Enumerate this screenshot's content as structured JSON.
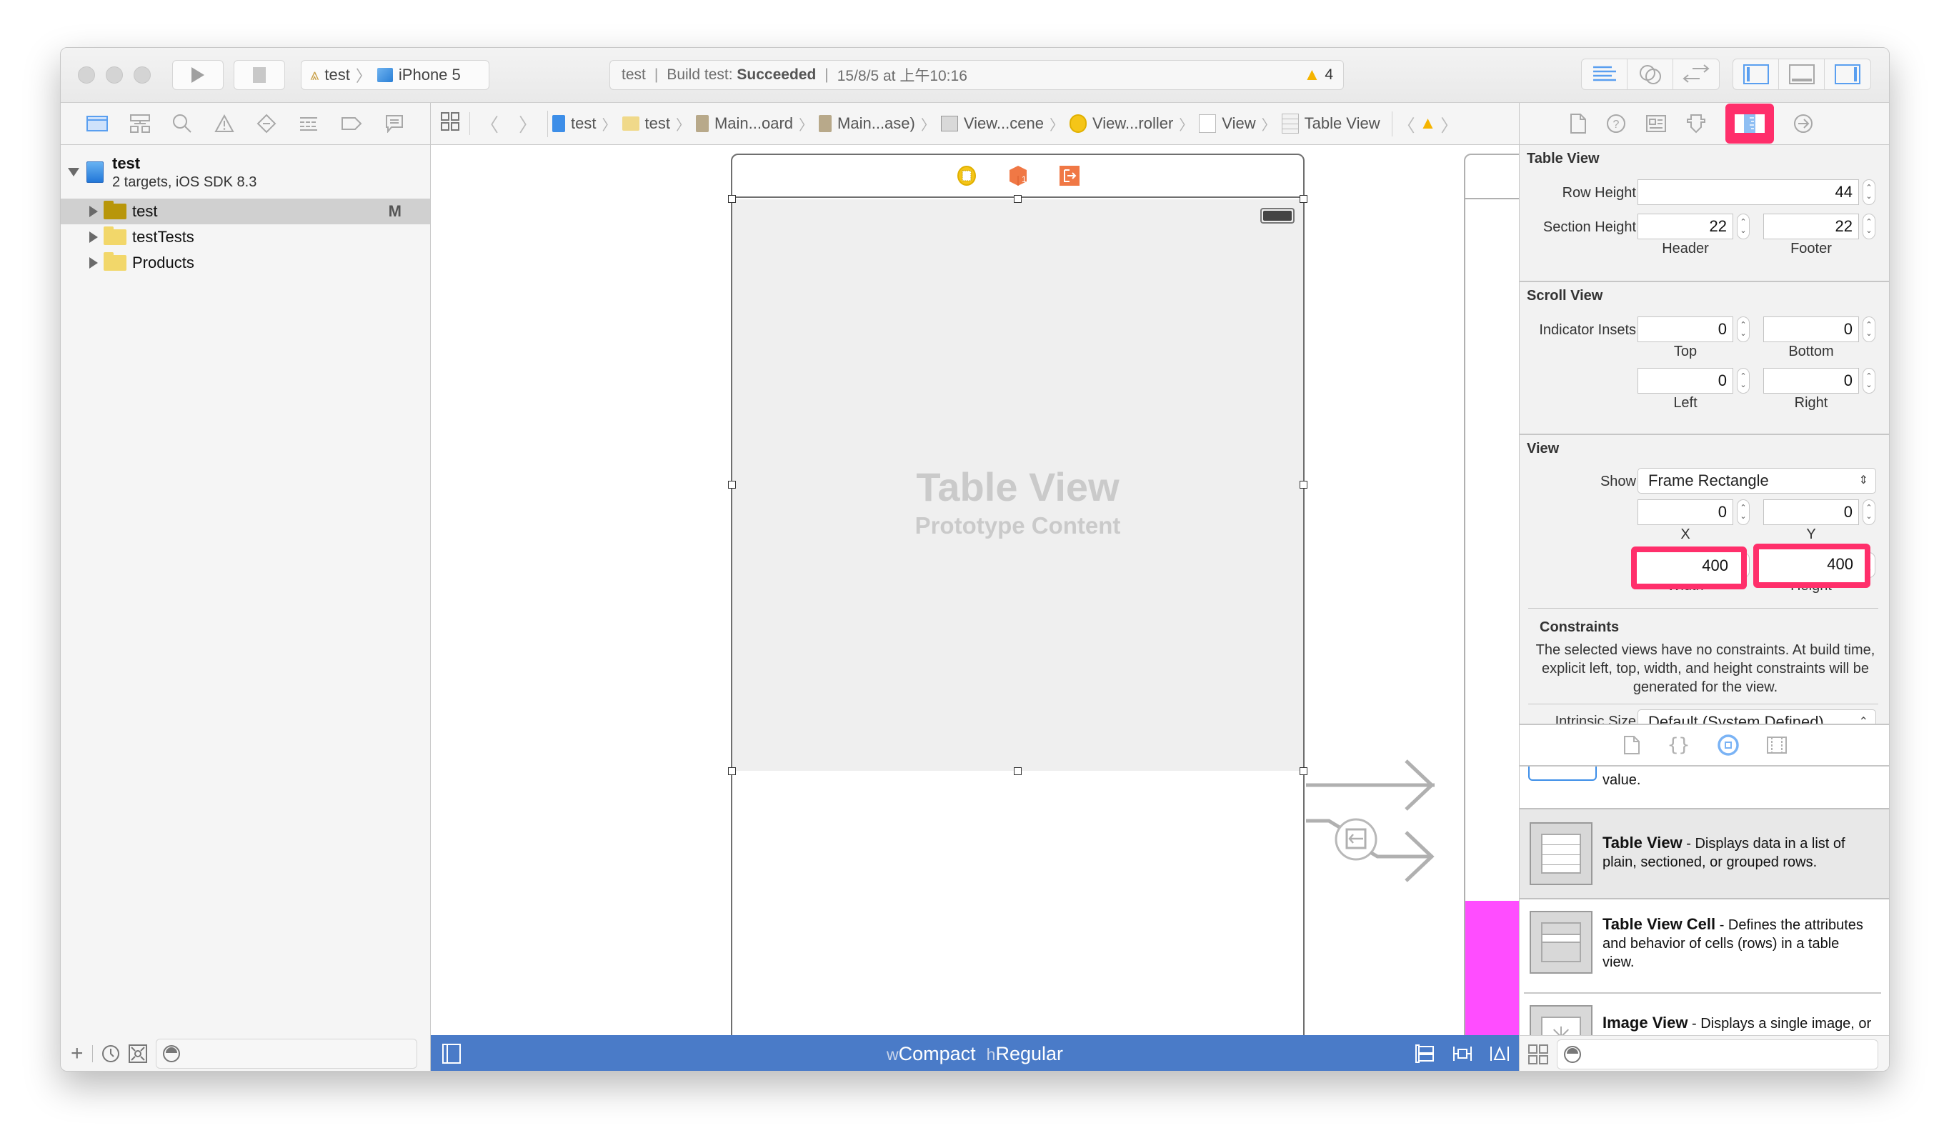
{
  "toolbar": {
    "run_label": "Run",
    "stop_label": "Stop",
    "scheme": {
      "project": "test",
      "device": "iPhone 5"
    },
    "activity": {
      "project": "test",
      "build_prefix": "Build test:",
      "build_status": "Succeeded",
      "timestamp": "15/8/5 at 上午10:16",
      "warning_count": "4"
    },
    "editor_modes": [
      "standard-editor",
      "assistant-editor",
      "version-editor"
    ],
    "view_toggles": [
      "navigator",
      "debug-area",
      "utilities"
    ]
  },
  "navigator": {
    "tabs": [
      "project",
      "symbol",
      "find",
      "issue",
      "test",
      "debug",
      "breakpoint",
      "report"
    ],
    "project": {
      "name": "test",
      "subtitle": "2 targets, iOS SDK 8.3"
    },
    "items": [
      {
        "name": "test",
        "badge": "M",
        "selected": true
      },
      {
        "name": "testTests",
        "badge": "",
        "selected": false
      },
      {
        "name": "Products",
        "badge": "",
        "selected": false
      }
    ]
  },
  "jumpbar": {
    "items": [
      {
        "label": "test",
        "icon": "project-icon"
      },
      {
        "label": "test",
        "icon": "folder-icon"
      },
      {
        "label": "Main...oard",
        "icon": "storyboard-icon"
      },
      {
        "label": "Main...ase)",
        "icon": "storyboard-icon"
      },
      {
        "label": "View...cene",
        "icon": "scene-icon"
      },
      {
        "label": "View...roller",
        "icon": "view-controller-icon"
      },
      {
        "label": "View",
        "icon": "view-icon"
      },
      {
        "label": "Table View",
        "icon": "table-view-icon"
      }
    ]
  },
  "canvas": {
    "table_view_title": "Table View",
    "table_view_subtitle": "Prototype Content",
    "size_class": {
      "w_prefix": "w",
      "width": "Compact",
      "h_prefix": "h",
      "height": "Regular"
    },
    "accent_color": "#4a7bc8",
    "highlight_color": "#ff2f6b"
  },
  "inspector": {
    "tabs": [
      "file",
      "quick-help",
      "identity",
      "attributes",
      "size",
      "connections"
    ],
    "active_tab": "size",
    "table_view": {
      "title": "Table View",
      "row_height_label": "Row Height",
      "row_height": "44",
      "section_height_label": "Section Height",
      "header": "22",
      "footer": "22",
      "header_label": "Header",
      "footer_label": "Footer"
    },
    "scroll_view": {
      "title": "Scroll View",
      "indicator_insets_label": "Indicator Insets",
      "top": "0",
      "bottom": "0",
      "left": "0",
      "right": "0",
      "top_label": "Top",
      "bottom_label": "Bottom",
      "left_label": "Left",
      "right_label": "Right"
    },
    "view": {
      "title": "View",
      "show_label": "Show",
      "show_value": "Frame Rectangle",
      "x": "0",
      "y": "0",
      "width": "400",
      "height": "400",
      "x_label": "X",
      "y_label": "Y",
      "width_label": "Width",
      "height_label": "Height"
    },
    "constraints": {
      "title": "Constraints",
      "text": "The selected views have no constraints. At build time, explicit left, top, width, and height constraints will be generated for the view."
    },
    "intrinsic_size": {
      "label": "Intrinsic Size",
      "value": "Default (System Defined)"
    }
  },
  "library": {
    "tabs": [
      "file-template",
      "code-snippet",
      "object",
      "media"
    ],
    "active_tab": "object",
    "partial_text": "value.",
    "items": [
      {
        "name": "Table View",
        "description": " - Displays data in a list of plain, sectioned, or grouped rows.",
        "selected": true
      },
      {
        "name": "Table View Cell",
        "description": " - Defines the attributes and behavior of cells (rows) in a table view.",
        "selected": false
      },
      {
        "name": "Image View",
        "description": " - Displays a single image, or an animation described by",
        "selected": false
      }
    ]
  }
}
